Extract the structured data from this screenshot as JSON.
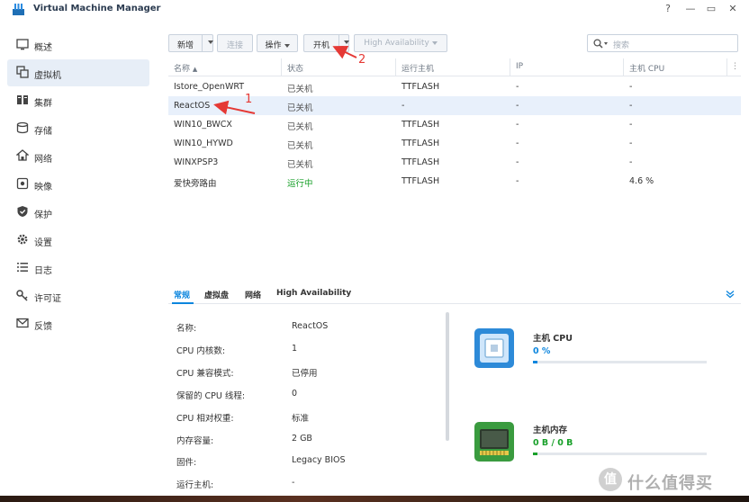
{
  "app": {
    "title": "Virtual Machine Manager"
  },
  "window_controls": {
    "help": "?",
    "minimize": "—",
    "maximize": "▭",
    "close": "✕"
  },
  "sidebar": {
    "items": [
      {
        "label": "概述",
        "icon": "overview-icon"
      },
      {
        "label": "虚拟机",
        "icon": "vm-icon",
        "active": true
      },
      {
        "label": "集群",
        "icon": "cluster-icon"
      },
      {
        "label": "存储",
        "icon": "storage-icon"
      },
      {
        "label": "网络",
        "icon": "network-icon"
      },
      {
        "label": "映像",
        "icon": "image-icon"
      },
      {
        "label": "保护",
        "icon": "shield-icon"
      },
      {
        "label": "设置",
        "icon": "gear-icon"
      },
      {
        "label": "日志",
        "icon": "log-icon"
      },
      {
        "label": "许可证",
        "icon": "key-icon"
      },
      {
        "label": "反馈",
        "icon": "mail-icon"
      }
    ]
  },
  "toolbar": {
    "new_label": "新增",
    "connect_label": "连接",
    "action_label": "操作",
    "power_on_label": "开机",
    "ha_label": "High Availability"
  },
  "search": {
    "placeholder": "搜索"
  },
  "grid": {
    "columns": [
      "名称",
      "状态",
      "运行主机",
      "IP",
      "主机 CPU"
    ],
    "rows": [
      {
        "name": "Istore_OpenWRT",
        "status": "已关机",
        "host": "TTFLASH",
        "ip": "-",
        "cpu": "-"
      },
      {
        "name": "ReactOS",
        "status": "已关机",
        "host": "-",
        "ip": "-",
        "cpu": "-",
        "selected": true
      },
      {
        "name": "WIN10_BWCX",
        "status": "已关机",
        "host": "TTFLASH",
        "ip": "-",
        "cpu": "-"
      },
      {
        "name": "WIN10_HYWD",
        "status": "已关机",
        "host": "TTFLASH",
        "ip": "-",
        "cpu": "-"
      },
      {
        "name": "WINXPSP3",
        "status": "已关机",
        "host": "TTFLASH",
        "ip": "-",
        "cpu": "-"
      },
      {
        "name": "爱快旁路由",
        "status": "运行中",
        "host": "TTFLASH",
        "ip": "-",
        "cpu": "4.6 %"
      }
    ]
  },
  "detail_tabs": [
    "常规",
    "虚拟盘",
    "网络",
    "High Availability"
  ],
  "details": [
    {
      "key": "名称:",
      "value": "ReactOS"
    },
    {
      "key": "CPU 内核数:",
      "value": "1"
    },
    {
      "key": "CPU 兼容模式:",
      "value": "已停用"
    },
    {
      "key": "保留的 CPU 线程:",
      "value": "0"
    },
    {
      "key": "CPU 相对权重:",
      "value": "标准"
    },
    {
      "key": "内存容量:",
      "value": "2 GB"
    },
    {
      "key": "固件:",
      "value": "Legacy BIOS"
    },
    {
      "key": "运行主机:",
      "value": "-"
    }
  ],
  "resources": {
    "cpu": {
      "title": "主机 CPU",
      "value": "0 %",
      "usage": 0.0,
      "color": "#0c86de"
    },
    "memory": {
      "title": "主机内存",
      "value": "0 B / 0 B",
      "usage": 0.0,
      "color": "#19a02a"
    }
  },
  "annotations": {
    "one": "1",
    "two": "2"
  },
  "watermark": {
    "logo": "值",
    "text": "什么值得买"
  },
  "colors": {
    "accent": "#0c86de",
    "running": "#19a02a",
    "annotation": "#e53935"
  }
}
